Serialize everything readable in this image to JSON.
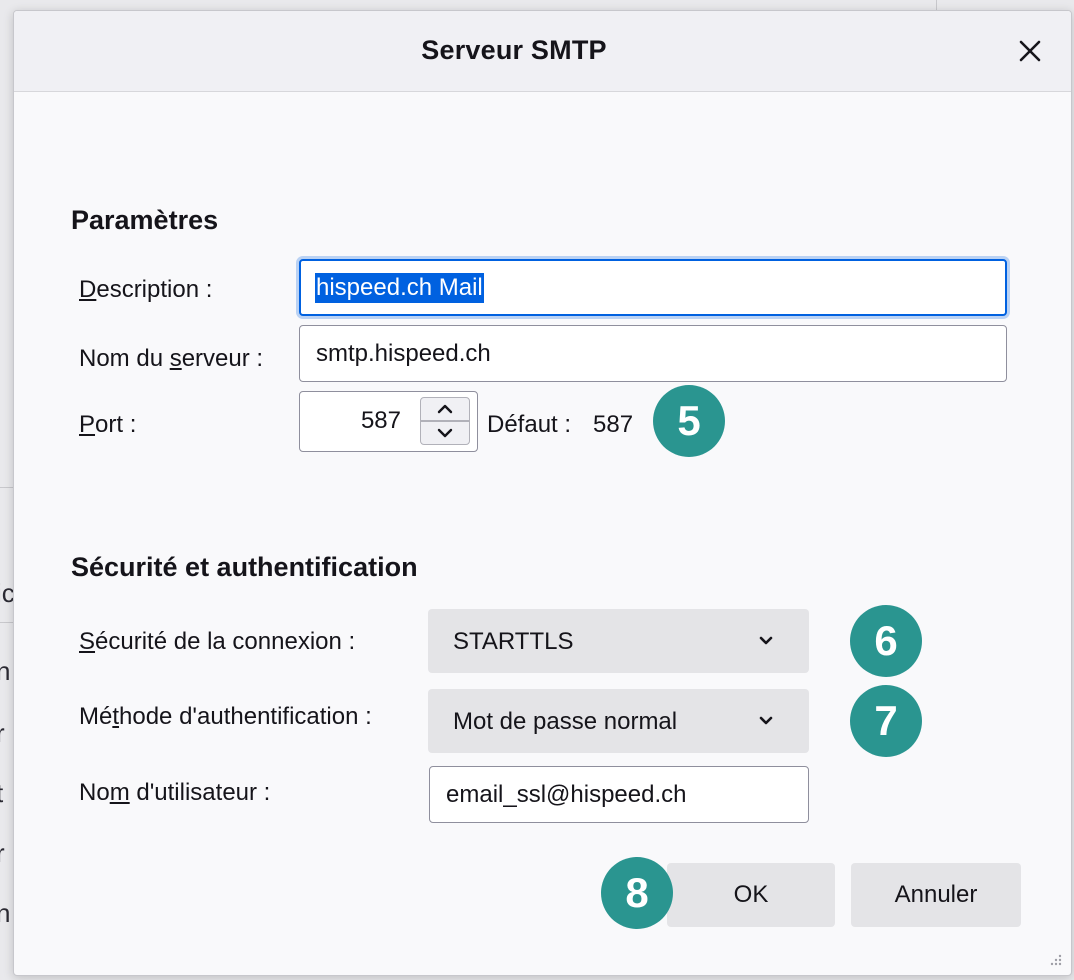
{
  "dialog": {
    "title": "Serveur SMTP",
    "close_icon": "close-icon"
  },
  "background": {
    "fragments": [
      "ic",
      "n",
      "r",
      "t",
      "r",
      "n"
    ]
  },
  "params": {
    "heading": "Paramètres",
    "description": {
      "label_pre": "",
      "label_key": "D",
      "label_post": "escription :",
      "value": "hispeed.ch Mail"
    },
    "server": {
      "label_pre": "Nom du ",
      "label_key": "s",
      "label_post": "erveur :",
      "value": "smtp.hispeed.ch"
    },
    "port": {
      "label_pre": "",
      "label_key": "P",
      "label_post": "ort :",
      "value": "587",
      "default_label": "Défaut :",
      "default_value": "587"
    }
  },
  "security": {
    "heading": "Sécurité et authentification",
    "connection": {
      "label_pre": "",
      "label_key": "S",
      "label_post": "écurité de la connexion :",
      "value": "STARTTLS"
    },
    "auth": {
      "label_pre": "Mé",
      "label_key": "t",
      "label_post": "hode d'authentification :",
      "value": "Mot de passe normal"
    },
    "username": {
      "label_pre": "No",
      "label_key": "m",
      "label_post": " d'utilisateur :",
      "value": "email_ssl@hispeed.ch"
    }
  },
  "buttons": {
    "ok": "OK",
    "cancel": "Annuler"
  },
  "badges": {
    "port": "5",
    "connection": "6",
    "auth": "7",
    "ok": "8"
  },
  "colors": {
    "badge": "#2a9590",
    "focus": "#0061e0",
    "selection": "#0061e0",
    "button_bg": "#e4e4e7"
  }
}
